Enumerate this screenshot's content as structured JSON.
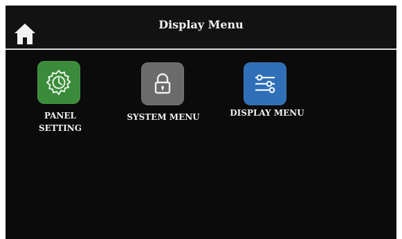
{
  "header": {
    "title": "Display Menu",
    "home_icon": "home-icon"
  },
  "menu": {
    "items": [
      {
        "label": "PANEL\nSETTING",
        "icon": "settings-clock-icon",
        "color": "#3a8b3a"
      },
      {
        "label": "SYSTEM MENU",
        "icon": "lock-icon",
        "color": "#6b6b6b"
      },
      {
        "label": "DISPLAY MENU",
        "icon": "sliders-icon",
        "color": "#2f6fb7"
      }
    ]
  }
}
